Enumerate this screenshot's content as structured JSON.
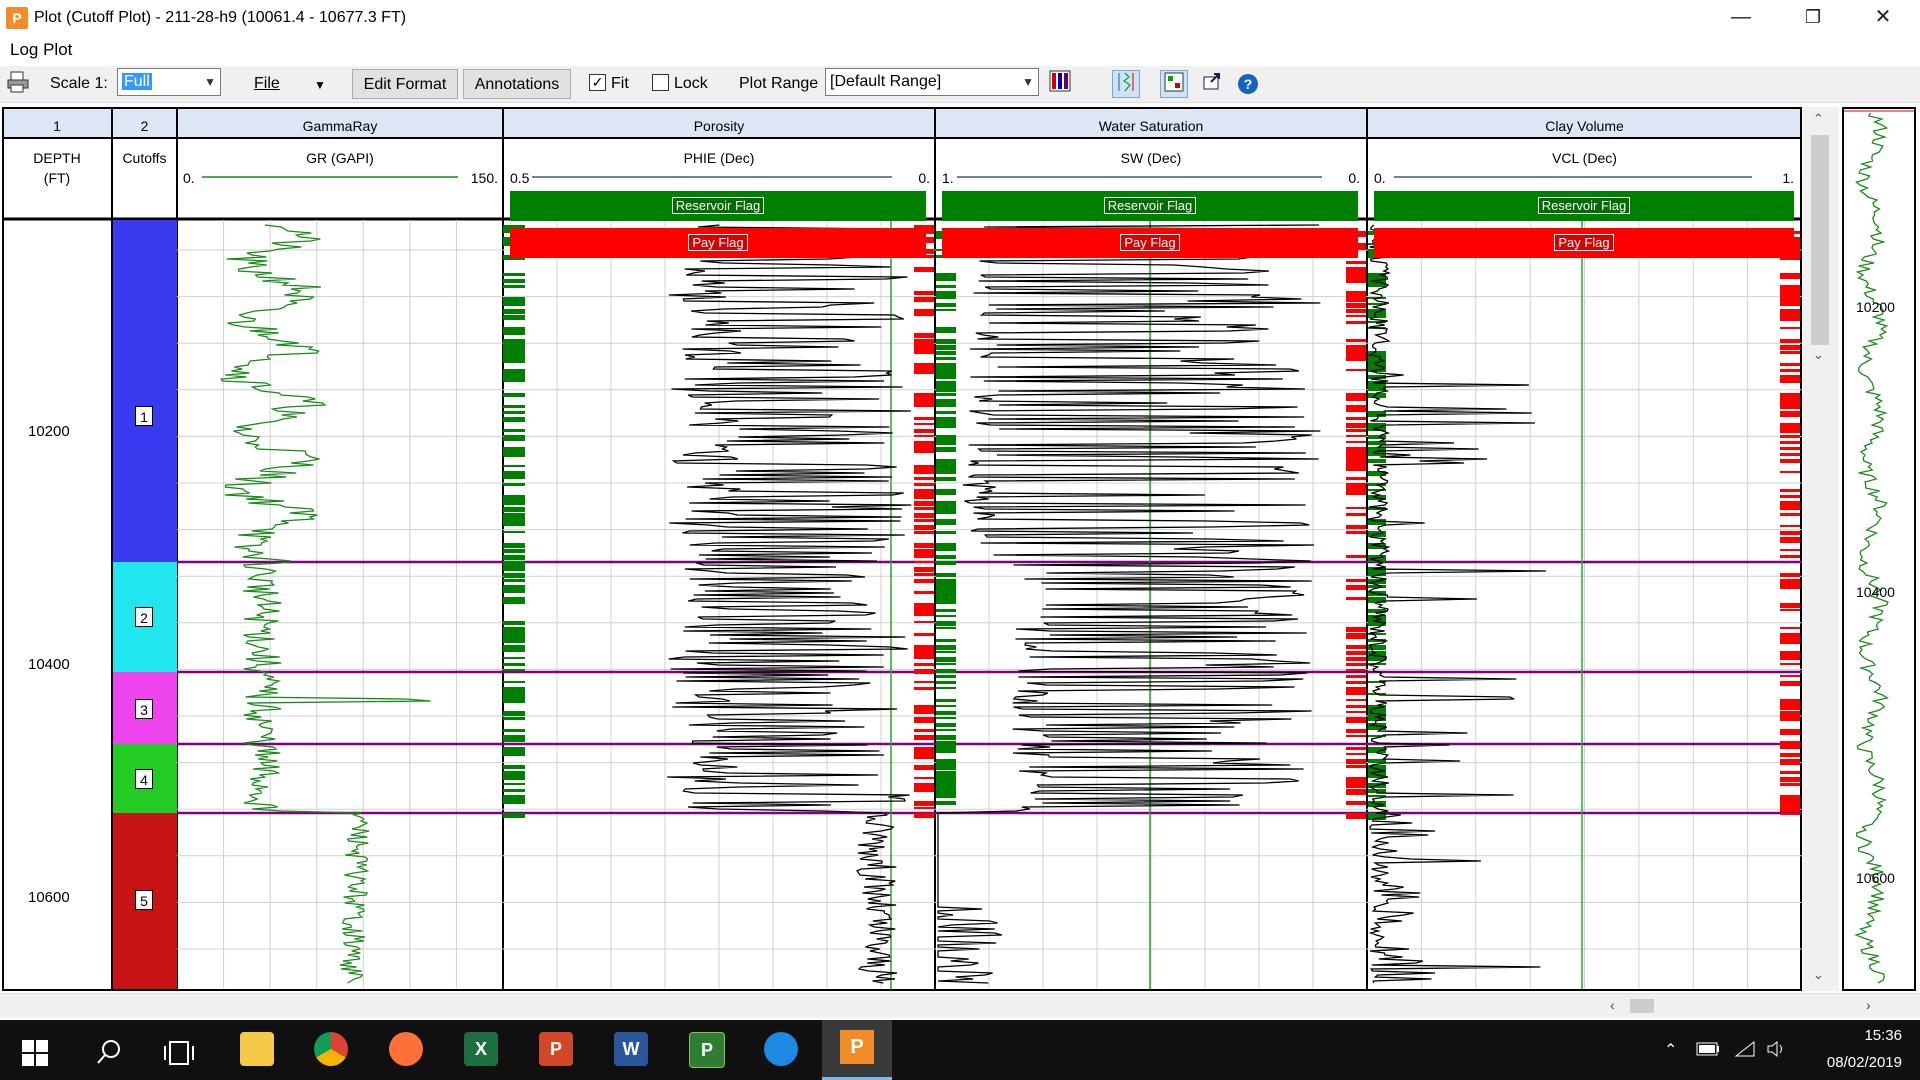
{
  "window": {
    "title": "Plot (Cutoff Plot) - 211-28-h9 (10061.4 - 10677.3 FT)",
    "minimize_glyph": "—",
    "restore_glyph": "❐",
    "close_glyph": "✕"
  },
  "menu": {
    "label": "Log Plot"
  },
  "toolbar": {
    "scale_label": "Scale 1:",
    "scale_value": "Full",
    "file_label": "File",
    "edit_format": "Edit Format",
    "annotations": "Annotations",
    "fit_label": "Fit",
    "fit_checked": true,
    "lock_label": "Lock",
    "lock_checked": false,
    "plot_range_label": "Plot Range",
    "plot_range_value": "[Default Range]",
    "dropdown_glyph": "▼",
    "help_glyph": "?"
  },
  "tracks": [
    {
      "number": "1",
      "curve": "DEPTH",
      "unit": "(FT)"
    },
    {
      "number": "2",
      "curve": "Cutoffs"
    },
    {
      "title": "GammaRay",
      "curve": "GR (GAPI)",
      "min": "0.",
      "max": "150."
    },
    {
      "title": "Porosity",
      "curve": "PHIE (Dec)",
      "min": "0.5",
      "max": "0."
    },
    {
      "title": "Water Saturation",
      "curve": "SW (Dec)",
      "min": "1.",
      "max": "0."
    },
    {
      "title": "Clay Volume",
      "curve": "VCL (Dec)",
      "min": "0.",
      "max": "1."
    }
  ],
  "flags": {
    "reservoir": "Reservoir Flag",
    "pay": "Pay Flag"
  },
  "depth_labels": [
    "10200",
    "10400",
    "10600"
  ],
  "zones": [
    {
      "label": "1",
      "color": "#3a3af0"
    },
    {
      "label": "2",
      "color": "#22e6ee"
    },
    {
      "label": "3",
      "color": "#ee44ee"
    },
    {
      "label": "4",
      "color": "#22cc22"
    },
    {
      "label": "5",
      "color": "#c81414"
    }
  ],
  "overview_labels": [
    "10200",
    "10400",
    "10600"
  ],
  "colors": {
    "green": "#008000",
    "red": "#ff0000",
    "purple": "#800080",
    "curve_green": "#1a8a1a"
  },
  "taskbar": {
    "time": "15:36",
    "date": "08/02/2019"
  }
}
